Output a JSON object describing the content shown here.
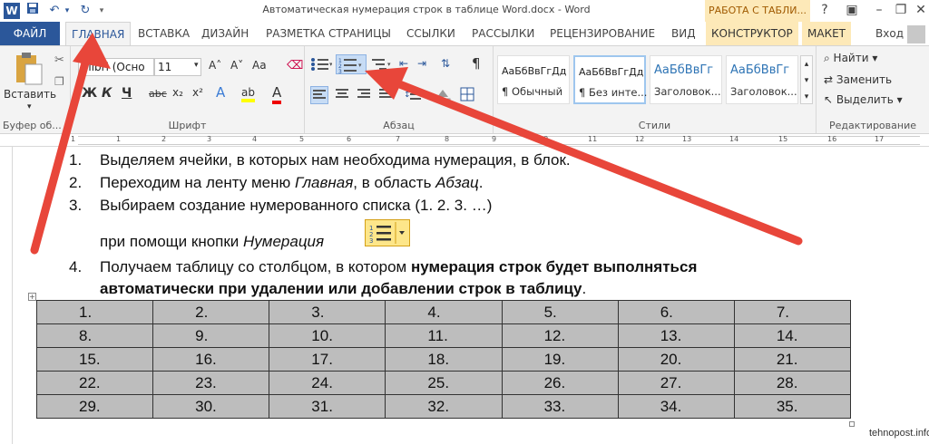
{
  "window": {
    "title": "Автоматическая нумерация строк в таблице Word.docx - Word",
    "context_tab_group": "РАБОТА С ТАБЛИ...",
    "help": "?",
    "minimize": "–",
    "restore": "❐",
    "close": "✕"
  },
  "quick_access": {
    "save_icon": "save-icon",
    "undo": "↶",
    "redo": "↻"
  },
  "tabs": {
    "file": "ФАЙЛ",
    "home": "ГЛАВНАЯ",
    "insert": "ВСТАВКА",
    "design": "ДИЗАЙН",
    "layout": "РАЗМЕТКА СТРАНИЦЫ",
    "references": "ССЫЛКИ",
    "mailings": "РАССЫЛКИ",
    "review": "РЕЦЕНЗИРОВАНИЕ",
    "view": "ВИД",
    "constructor": "КОНСТРУКТОР",
    "maket": "МАКЕТ",
    "signin": "Вход"
  },
  "ribbon": {
    "clipboard": {
      "paste": "Вставить",
      "label": "Буфер об..."
    },
    "font": {
      "name": "alibri (Осно",
      "size": "11",
      "grow": "A˄",
      "shrink": "A˅",
      "case": "Aa",
      "bold": "Ж",
      "italic": "К",
      "underline": "Ч",
      "strike": "abc",
      "sub": "x₂",
      "sup": "x²",
      "effects": "A",
      "highlight": "ab",
      "color": "A",
      "label": "Шрифт"
    },
    "paragraph": {
      "label": "Абзац",
      "pilcrow": "¶"
    },
    "styles": {
      "label": "Стили",
      "items": [
        {
          "sample": "АаБбВвГгДд",
          "name": "¶ Обычный"
        },
        {
          "sample": "АаБбВвГгДд",
          "name": "¶ Без инте..."
        },
        {
          "sample": "АаБбВвГг",
          "name": "Заголовок..."
        },
        {
          "sample": "АаБбВвГг",
          "name": "Заголовок..."
        }
      ]
    },
    "editing": {
      "label": "Редактирование",
      "find": "Найти",
      "replace": "Заменить",
      "select": "Выделить"
    }
  },
  "ruler": {
    "ticks": [
      "1",
      "2",
      "1",
      "2",
      "3",
      "4",
      "5",
      "6",
      "7",
      "8",
      "9",
      "10",
      "11",
      "12",
      "13",
      "14",
      "15",
      "16",
      "17"
    ]
  },
  "document": {
    "items": [
      {
        "num": "1.",
        "text": "Выделяем ячейки, в которых нам необходима нумерация, в блок."
      },
      {
        "num": "2.",
        "pre": "Переходим на ленту меню ",
        "em1": "Главная",
        "mid": ", в область ",
        "em2": "Абзац",
        "post": "."
      },
      {
        "num": "3.",
        "text": "Выбираем создание нумерованного списка (1. 2. 3. …)"
      },
      {
        "text_pre": "при помощи кнопки ",
        "text_em": "Нумерация"
      },
      {
        "num": "4.",
        "pre": "Получаем таблицу со столбцом, в котором ",
        "bold1": "нумерация строк будет выполняться",
        "bold2": "автоматически при удалении или добавлении строк в таблицу",
        "post": "."
      }
    ],
    "table": [
      [
        "1.",
        "2.",
        "3.",
        "4.",
        "5.",
        "6.",
        "7."
      ],
      [
        "8.",
        "9.",
        "10.",
        "11.",
        "12.",
        "13.",
        "14."
      ],
      [
        "15.",
        "16.",
        "17.",
        "18.",
        "19.",
        "20.",
        "21."
      ],
      [
        "22.",
        "23.",
        "24.",
        "25.",
        "26.",
        "27.",
        "28."
      ],
      [
        "29.",
        "30.",
        "31.",
        "32.",
        "33.",
        "34.",
        "35."
      ]
    ]
  },
  "watermark": "tehnopost.info",
  "colors": {
    "word_blue": "#2b579a",
    "context_tab": "#fde9b8",
    "arrow_red": "#e8463a",
    "table_fill": "#bdbdbd"
  }
}
